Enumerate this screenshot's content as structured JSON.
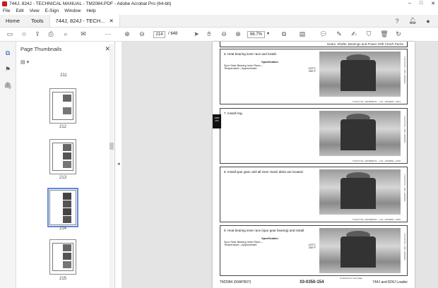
{
  "window": {
    "title": "744J, 824J - TECHNICAL MANUAL - TM2084.PDF - Adobe Acrobat Pro (64-bit)"
  },
  "menu": [
    "File",
    "Edit",
    "View",
    "E-Sign",
    "Window",
    "Help"
  ],
  "tabs": {
    "home": "Home",
    "tools": "Tools",
    "doc": "744J, 824J - TECH..."
  },
  "toolbar": {
    "page_current": "214",
    "page_total": "/ 648",
    "zoom": "66.7%"
  },
  "panel": {
    "title": "Page Thumbnails"
  },
  "thumbnails": [
    {
      "label": "211"
    },
    {
      "label": "212"
    },
    {
      "label": "213"
    },
    {
      "label": "214"
    },
    {
      "label": "215"
    }
  ],
  "doc": {
    "header": "Gears, Shafts, Bearings and Power Shift Clutch Packs",
    "sidetab": "0350 254",
    "steps": [
      {
        "text": "6.  Heat bearing inner race and install.",
        "spec": {
          "heading": "Specification",
          "line1": "Spur Gear Bearing Inner Race—",
          "line2": "Temperature—Approximate",
          "v1": "120°C",
          "v2": "250°F"
        },
        "code": "TX1147719—EN08SEP11    —UN—24FEB04—0244",
        "vcode": "TX1147719  —UN—20FEB11"
      },
      {
        "text": "7.  Install ring.",
        "code": "TX1147719—EN08SEP11    —UN—24FEB04—0245",
        "vcode": "TX1147719  —UN—20FEB11"
      },
      {
        "text": "8.  Install spur gear until all inner clutch disks are located.",
        "code": "TX1147719—EN08SEP11    —UN—24FEB04—0246",
        "vcode": "TX1147719  —UN—20FEB11"
      },
      {
        "text": "9.  Heat bearing inner race (spur gear bearing) and install.",
        "spec": {
          "heading": "Specification",
          "line1": "Spur Gear Bearing Inner Race—",
          "line2": "Temperature—Approximate",
          "v1": "120°C",
          "v2": "250°F"
        },
        "vcode": "TX1147719  —UN—20FEB11"
      }
    ],
    "continued": "Continued on next page",
    "footer_left": "TM2084 (09APR07)",
    "footer_center": "03-0350-154",
    "footer_right": "744J and 824J Loader"
  },
  "colors": {
    "accent": "#5a8bd8",
    "pdf_red": "#c41e1e"
  }
}
